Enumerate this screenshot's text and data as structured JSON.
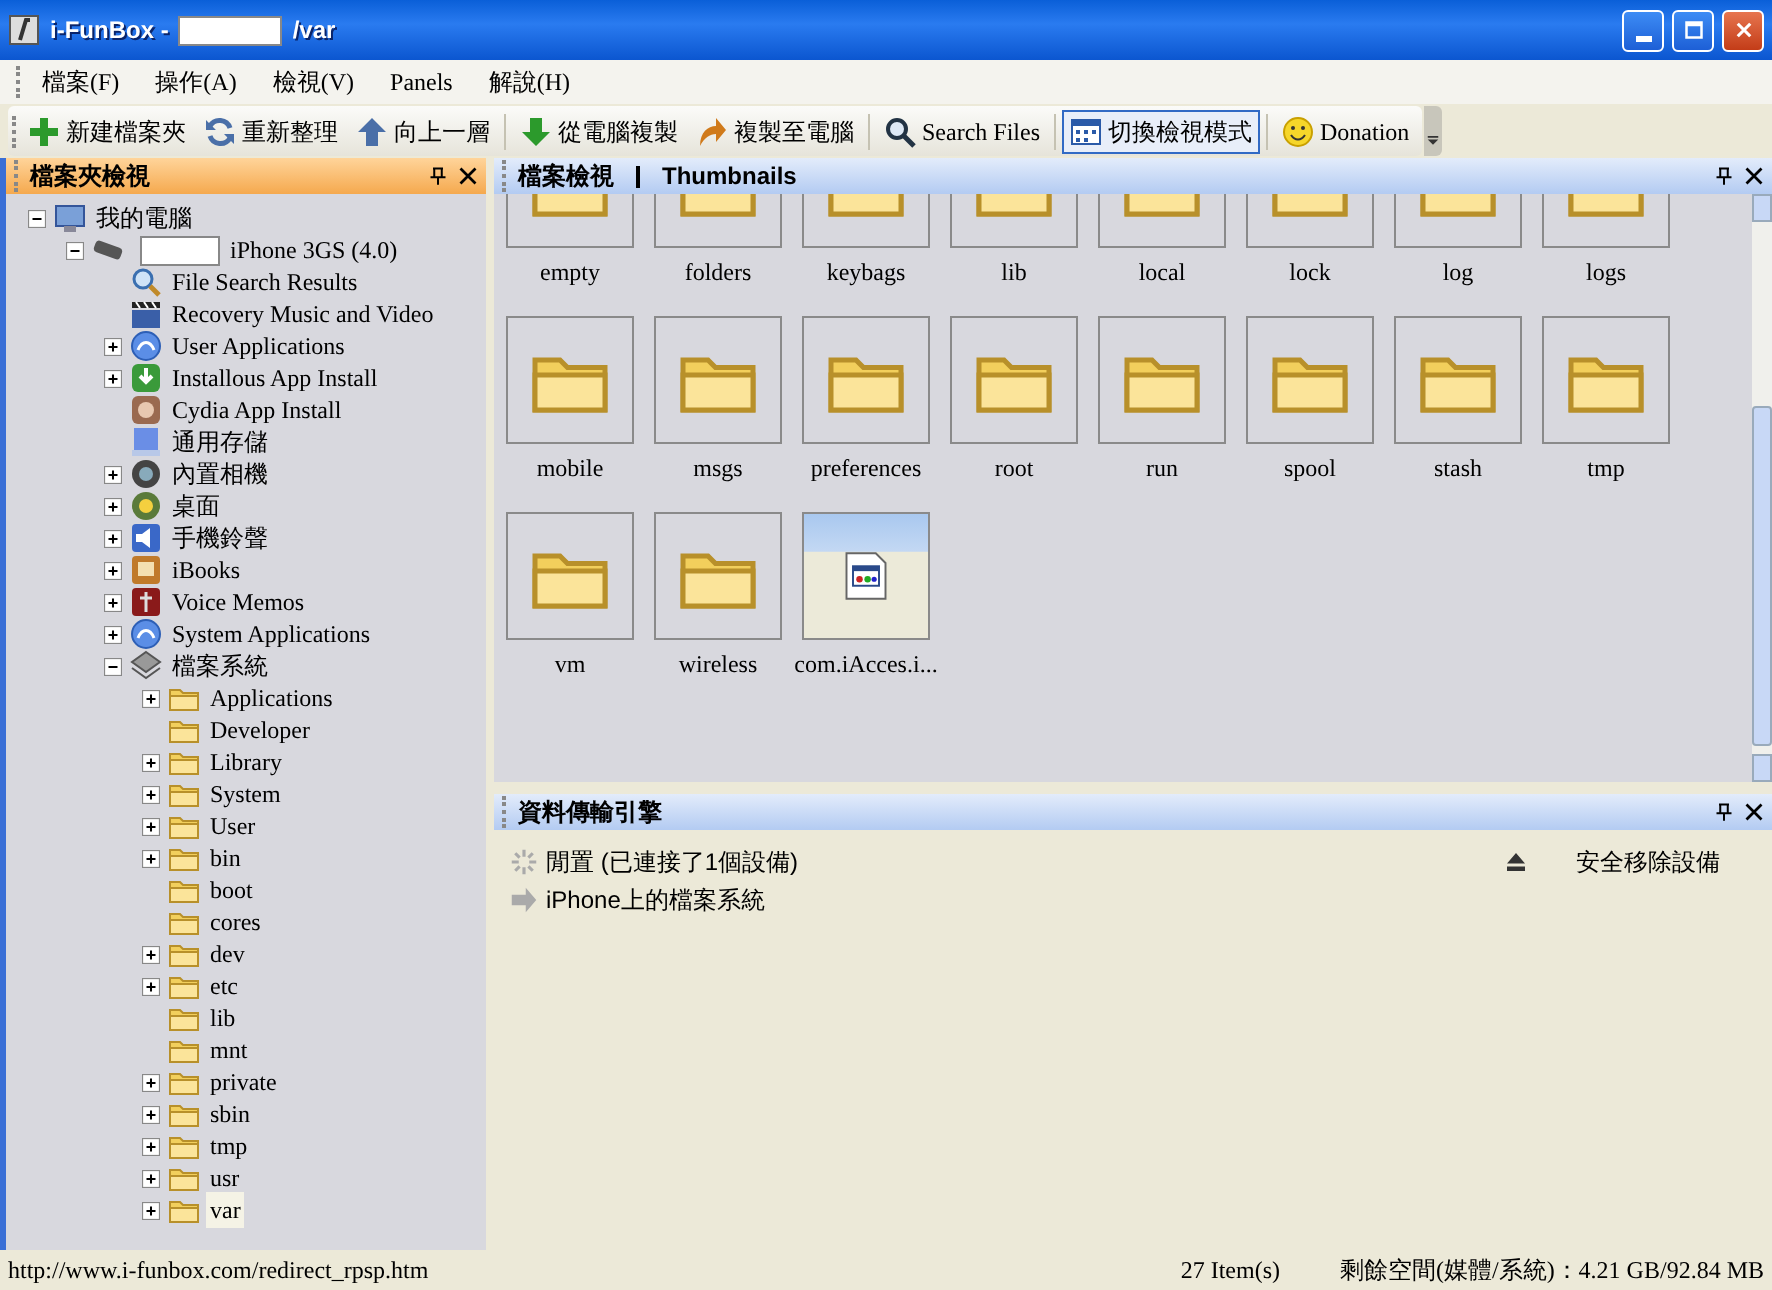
{
  "window": {
    "title_prefix": "i-FunBox -",
    "title_redacted": true,
    "title_suffix": "/var"
  },
  "menu": [
    "檔案(F)",
    "操作(A)",
    "檢視(V)",
    "Panels",
    "解說(H)"
  ],
  "toolbar": [
    {
      "label": "新建檔案夾",
      "kind": "plus",
      "pressed": false,
      "separator_after": false
    },
    {
      "label": "重新整理",
      "kind": "refresh",
      "pressed": false,
      "separator_after": false
    },
    {
      "label": "向上一層",
      "kind": "up",
      "pressed": false,
      "separator_after": true
    },
    {
      "label": "從電腦複製",
      "kind": "down",
      "pressed": false,
      "separator_after": false
    },
    {
      "label": "複製至電腦",
      "kind": "export",
      "pressed": false,
      "separator_after": true
    },
    {
      "label": "Search Files",
      "kind": "search",
      "pressed": false,
      "separator_after": true
    },
    {
      "label": "切換檢視模式",
      "kind": "view",
      "pressed": true,
      "separator_after": true
    },
    {
      "label": "Donation",
      "kind": "donate",
      "pressed": false,
      "separator_after": false
    }
  ],
  "folder_panel": {
    "title": "檔案夾檢視",
    "tree": [
      {
        "label": "我的電腦",
        "kind": "computer",
        "expandable": true,
        "expanded": true,
        "selected": false,
        "children": [
          {
            "label": "iPhone 3GS (4.0)",
            "redacted": true,
            "kind": "phone",
            "expandable": true,
            "expanded": true,
            "selected": false,
            "children": [
              {
                "label": "File Search Results",
                "kind": "search",
                "expandable": false,
                "selected": false
              },
              {
                "label": "Recovery Music and Video",
                "kind": "video",
                "expandable": false,
                "selected": false
              },
              {
                "label": "User Applications",
                "kind": "apps",
                "expandable": true,
                "expanded": false,
                "selected": false
              },
              {
                "label": "Installous App Install",
                "kind": "install",
                "expandable": true,
                "expanded": false,
                "selected": false
              },
              {
                "label": "Cydia App Install",
                "kind": "cydia",
                "expandable": false,
                "selected": false
              },
              {
                "label": "通用存儲",
                "kind": "storage",
                "expandable": false,
                "selected": false
              },
              {
                "label": "內置相機",
                "kind": "camera",
                "expandable": true,
                "expanded": false,
                "selected": false
              },
              {
                "label": "桌面",
                "kind": "desktop",
                "expandable": true,
                "expanded": false,
                "selected": false
              },
              {
                "label": "手機鈴聲",
                "kind": "ringtone",
                "expandable": true,
                "expanded": false,
                "selected": false
              },
              {
                "label": "iBooks",
                "kind": "books",
                "expandable": true,
                "expanded": false,
                "selected": false
              },
              {
                "label": "Voice Memos",
                "kind": "memos",
                "expandable": true,
                "expanded": false,
                "selected": false
              },
              {
                "label": "System Applications",
                "kind": "apps",
                "expandable": true,
                "expanded": false,
                "selected": false
              },
              {
                "label": "檔案系統",
                "kind": "filesystem",
                "expandable": true,
                "expanded": true,
                "selected": false,
                "children": [
                  {
                    "label": "Applications",
                    "kind": "folder",
                    "expandable": true,
                    "expanded": false,
                    "selected": false
                  },
                  {
                    "label": "Developer",
                    "kind": "folder",
                    "expandable": false,
                    "selected": false
                  },
                  {
                    "label": "Library",
                    "kind": "folder",
                    "expandable": true,
                    "expanded": false,
                    "selected": false
                  },
                  {
                    "label": "System",
                    "kind": "folder",
                    "expandable": true,
                    "expanded": false,
                    "selected": false
                  },
                  {
                    "label": "User",
                    "kind": "folder",
                    "expandable": true,
                    "expanded": false,
                    "selected": false
                  },
                  {
                    "label": "bin",
                    "kind": "folder",
                    "expandable": true,
                    "expanded": false,
                    "selected": false
                  },
                  {
                    "label": "boot",
                    "kind": "folder",
                    "expandable": false,
                    "selected": false
                  },
                  {
                    "label": "cores",
                    "kind": "folder",
                    "expandable": false,
                    "selected": false
                  },
                  {
                    "label": "dev",
                    "kind": "folder",
                    "expandable": true,
                    "expanded": false,
                    "selected": false
                  },
                  {
                    "label": "etc",
                    "kind": "folder",
                    "expandable": true,
                    "expanded": false,
                    "selected": false
                  },
                  {
                    "label": "lib",
                    "kind": "folder",
                    "expandable": false,
                    "selected": false
                  },
                  {
                    "label": "mnt",
                    "kind": "folder",
                    "expandable": false,
                    "selected": false
                  },
                  {
                    "label": "private",
                    "kind": "folder",
                    "expandable": true,
                    "expanded": false,
                    "selected": false
                  },
                  {
                    "label": "sbin",
                    "kind": "folder",
                    "expandable": true,
                    "expanded": false,
                    "selected": false
                  },
                  {
                    "label": "tmp",
                    "kind": "folder",
                    "expandable": true,
                    "expanded": false,
                    "selected": false
                  },
                  {
                    "label": "usr",
                    "kind": "folder",
                    "expandable": true,
                    "expanded": false,
                    "selected": false
                  },
                  {
                    "label": "var",
                    "kind": "folder",
                    "expandable": true,
                    "expanded": false,
                    "selected": true
                  }
                ]
              }
            ]
          }
        ]
      }
    ]
  },
  "file_panel": {
    "title": "檔案檢視",
    "view": "Thumbnails",
    "items": [
      {
        "label": "empty",
        "kind": "folder"
      },
      {
        "label": "folders",
        "kind": "folder"
      },
      {
        "label": "keybags",
        "kind": "folder"
      },
      {
        "label": "lib",
        "kind": "folder"
      },
      {
        "label": "local",
        "kind": "folder"
      },
      {
        "label": "lock",
        "kind": "folder"
      },
      {
        "label": "log",
        "kind": "folder"
      },
      {
        "label": "logs",
        "kind": "folder"
      },
      {
        "label": "mobile",
        "kind": "folder"
      },
      {
        "label": "msgs",
        "kind": "folder"
      },
      {
        "label": "preferences",
        "kind": "folder"
      },
      {
        "label": "root",
        "kind": "folder"
      },
      {
        "label": "run",
        "kind": "folder"
      },
      {
        "label": "spool",
        "kind": "folder"
      },
      {
        "label": "stash",
        "kind": "folder"
      },
      {
        "label": "tmp",
        "kind": "folder"
      },
      {
        "label": "vm",
        "kind": "folder"
      },
      {
        "label": "wireless",
        "kind": "folder"
      },
      {
        "label": "com.iAcces.i...",
        "kind": "file"
      }
    ]
  },
  "transfer_panel": {
    "title": "資料傳輸引擎",
    "status": "閒置 (已連接了1個設備)",
    "eject_label": "安全移除設備",
    "tasks": [
      "iPhone上的檔案系統"
    ]
  },
  "status_bar": {
    "url": "http://www.i-funbox.com/redirect_rpsp.htm",
    "items": "27 Item(s)",
    "free_space": "剩餘空間(媒體/系統)：4.21 GB/92.84 MB"
  }
}
